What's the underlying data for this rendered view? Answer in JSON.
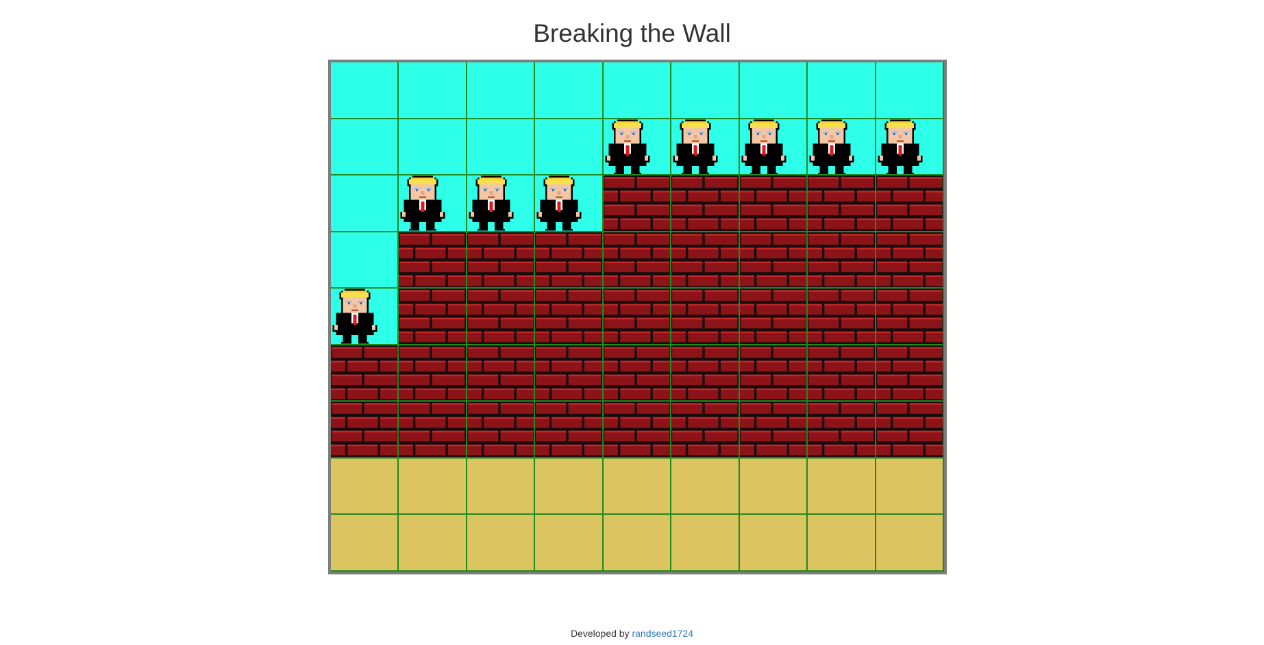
{
  "page": {
    "title": "Breaking the Wall"
  },
  "board": {
    "columns": 9,
    "rows": 9,
    "colors": {
      "sky": "#2effe8",
      "brick": "#8c1418",
      "mortar": "#1a0c0c",
      "sand": "#dcc560",
      "grid": "#1f8a1f",
      "frame": "#7b7f7a"
    },
    "wall_heights": [
      2,
      4,
      4,
      4,
      5,
      5,
      5,
      5,
      5
    ],
    "sand_rows": 2,
    "character_icon": "blonde-man-in-suit-icon"
  },
  "footer": {
    "prefix": "Developed by",
    "author_link": "randseed1724"
  }
}
